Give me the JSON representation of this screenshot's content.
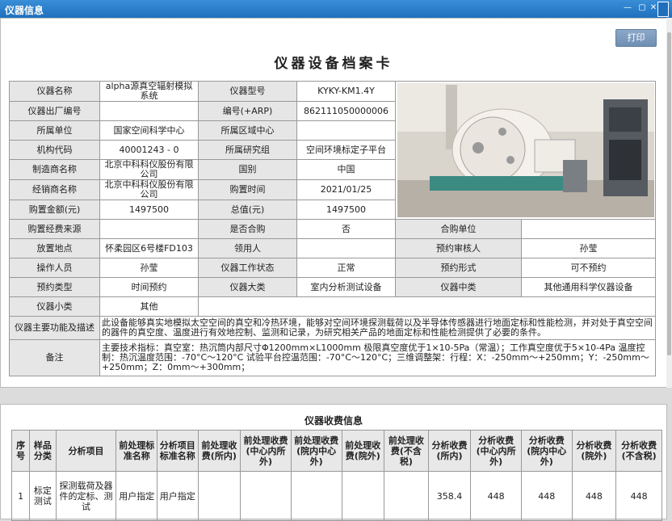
{
  "window": {
    "title": "仪器信息"
  },
  "toolbar": {
    "print_label": "打印"
  },
  "card": {
    "title": "仪器设备档案卡"
  },
  "info": {
    "instrument_name_label": "仪器名称",
    "instrument_name": "alpha源真空辐射模拟系统",
    "model_label": "仪器型号",
    "model": "KYKY-KM1.4Y",
    "factory_no_label": "仪器出厂编号",
    "factory_no": "",
    "arp_label": "编号(+ARP)",
    "arp": "862111050000006",
    "unit_label": "所属单位",
    "unit": "国家空间科学中心",
    "region_label": "所属区域中心",
    "region": "",
    "org_code_label": "机构代码",
    "org_code": "40001243 - 0",
    "group_label": "所属研究组",
    "group": "空间环境标定子平台",
    "manufacturer_label": "制造商名称",
    "manufacturer": "北京中科科仪股份有限公司",
    "country_label": "国别",
    "country": "中国",
    "dealer_label": "经销商名称",
    "dealer": "北京中科科仪股份有限公司",
    "purchase_date_label": "购置时间",
    "purchase_date": "2021/01/25",
    "purchase_amount_label": "购置金额(元)",
    "purchase_amount": "1497500",
    "total_value_label": "总值(元)",
    "total_value": "1497500",
    "funding_label": "购置经费来源",
    "funding": "",
    "joint_purchase_label": "是否合购",
    "joint_purchase": "否",
    "joint_unit_label": "合购单位",
    "joint_unit": "",
    "location_label": "放置地点",
    "location": "怀柔园区6号楼FD103",
    "receiver_label": "领用人",
    "receiver": "",
    "reviewer_label": "预约审核人",
    "reviewer": "孙莹",
    "operator_label": "操作人员",
    "operator": "孙莹",
    "work_status_label": "仪器工作状态",
    "work_status": "正常",
    "booking_form_label": "预约形式",
    "booking_form": "可不预约",
    "booking_type_label": "预约类型",
    "booking_type": "时间预约",
    "major_class_label": "仪器大类",
    "major_class": "室内分析测试设备",
    "mid_class_label": "仪器中类",
    "mid_class": "其他通用科学仪器设备",
    "minor_class_label": "仪器小类",
    "minor_class": "其他",
    "function_label": "仪器主要功能及描述",
    "function": "此设备能够真实地模拟太空空间的真空和冷热环境，能够对空间环境探测载荷以及半导体传感器进行地面定标和性能检测，并对处于真空空间的器件的真空度、温度进行有效地控制、监测和记录，为研究相关产品的地面定标和性能检测提供了必要的条件。",
    "remark_label": "备注",
    "remark": "主要技术指标：真空室：热沉筒内部尺寸Φ1200mm×L1000mm 极限真空度优于1×10-5Pa（常温）；工作真空度优于5×10-4Pa 温度控制：热沉温度范围：-70°C～120°C 试验平台控温范围：-70°C～120°C；三维调整架：行程：X：-250mm～+250mm；Y：-250mm～+250mm；Z：0mm～+300mm；"
  },
  "fees": {
    "title": "仪器收费信息",
    "headers": [
      "序号",
      "样品分类",
      "分析项目",
      "前处理标准名称",
      "分析项目标准名称",
      "前处理收费(所内)",
      "前处理收费(中心内所外)",
      "前处理收费(院内中心外)",
      "前处理收费(院外)",
      "前处理收费(不含税)",
      "分析收费(所内)",
      "分析收费(中心内所外)",
      "分析收费(院内中心外)",
      "分析收费(院外)",
      "分析收费(不含税)"
    ],
    "rows": [
      [
        "1",
        "标定测试",
        "探测载荷及器件的定标、测试",
        "用户指定",
        "用户指定",
        "",
        "",
        "",
        "",
        "",
        "358.4",
        "448",
        "448",
        "448",
        "448"
      ]
    ]
  }
}
